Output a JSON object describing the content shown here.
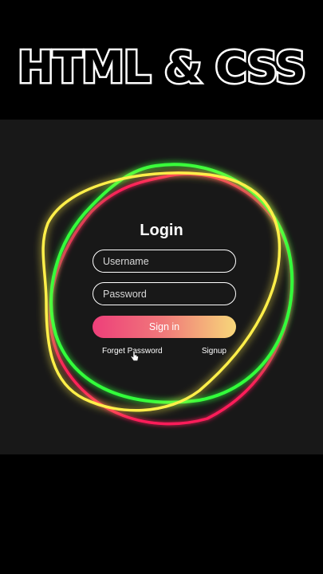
{
  "banner": {
    "title": "HTML & CSS"
  },
  "login": {
    "title": "Login",
    "username_placeholder": "Username",
    "password_placeholder": "Password",
    "signin_label": "Sign in",
    "forget_password_label": "Forget Password",
    "signup_label": "Signup"
  },
  "colors": {
    "background": "#000000",
    "stage": "#181818",
    "ring_green": "#33ff3a",
    "ring_red": "#ff1f5a",
    "ring_yellow": "#ffef4a",
    "button_gradient_start": "#ee3f7a",
    "button_gradient_end": "#f7d77a"
  }
}
